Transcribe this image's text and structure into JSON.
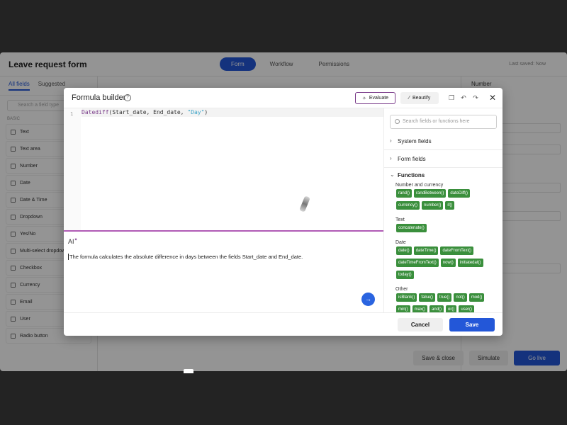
{
  "app": {
    "title": "Leave request form",
    "tabs": [
      "Form",
      "Workflow",
      "Permissions"
    ],
    "saved": "Last saved: Now",
    "left_tabs": [
      "All fields",
      "Suggested"
    ],
    "search_placeholder": "Search a field type",
    "section": "BASIC",
    "field_types": [
      "Text",
      "Text area",
      "Number",
      "Date",
      "Date & Time",
      "Dropdown",
      "Yes/No",
      "Multi-select dropdown",
      "Checkbox",
      "Currency",
      "Email",
      "User",
      "Radio button"
    ],
    "right_title": "Number",
    "actions": [
      "Save & close",
      "Simulate",
      "Go live"
    ]
  },
  "modal": {
    "title": "Formula builder",
    "evaluate": "Evaluate",
    "beautify": "Beautify",
    "line_number": "1",
    "code": {
      "fn": "Datediff",
      "open": "(Start_date, End_date, ",
      "str": "\"Day\"",
      "close": ")"
    },
    "ai_label": "AI",
    "ai_text": "The formula calculates the absolute difference in days between the fields Start_date and End_date.",
    "search_placeholder": "Search fields or functions here",
    "groups": [
      "System fields",
      "Form fields"
    ],
    "functions_label": "Functions",
    "categories": [
      {
        "name": "Number and currency",
        "rows": [
          [
            "rand()",
            "randBetween()",
            "dateDiff()"
          ],
          [
            "currency()",
            "number()",
            "if()"
          ]
        ]
      },
      {
        "name": "Text",
        "rows": [
          [
            "concatenate()"
          ]
        ]
      },
      {
        "name": "Date",
        "rows": [
          [
            "date()",
            "dateTime()",
            "dateFromText()"
          ],
          [
            "dateTimeFromText()",
            "now()",
            "initiatedat()"
          ],
          [
            "today()"
          ]
        ]
      },
      {
        "name": "Other",
        "rows": [
          [
            "isBlank()",
            "false()",
            "true()",
            "not()",
            "mod()"
          ],
          [
            "min()",
            "max()",
            "and()",
            "or()",
            "user()"
          ]
        ]
      }
    ],
    "cancel": "Cancel",
    "save": "Save"
  },
  "colors": {
    "accent": "#2357d8",
    "chip": "#3a8f3c",
    "ai_border": "#b05bb5"
  }
}
